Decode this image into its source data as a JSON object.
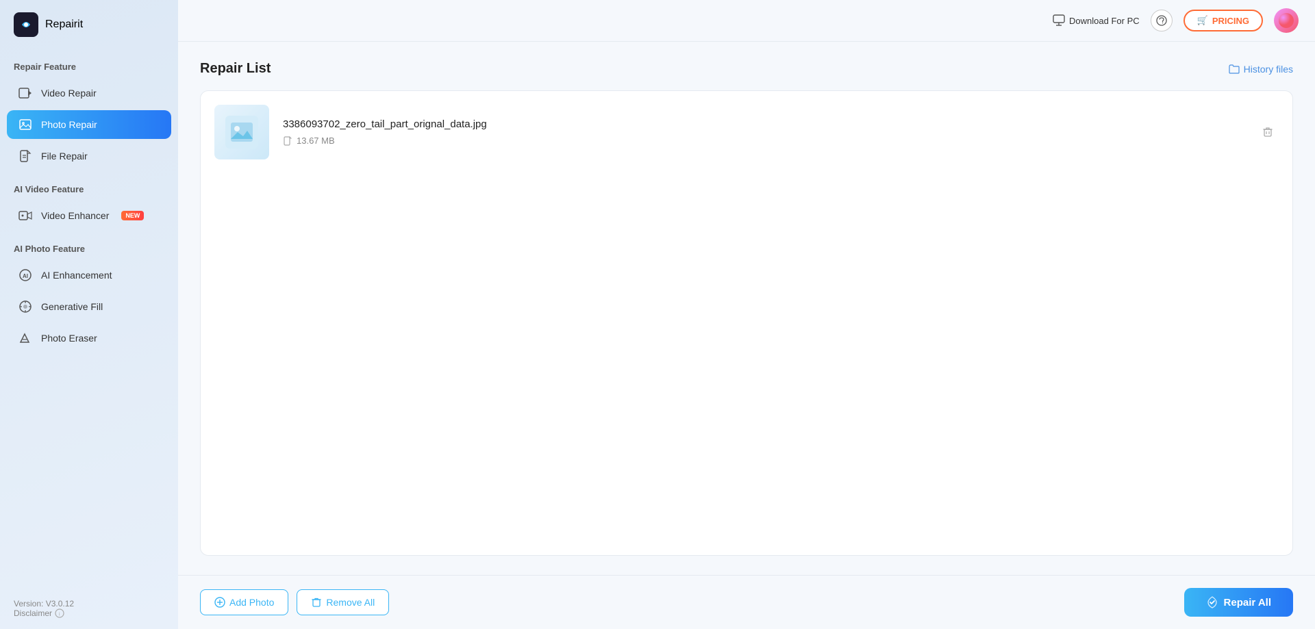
{
  "app": {
    "name": "Repairit"
  },
  "topbar": {
    "download_for_pc": "Download For PC",
    "pricing_label": "PRICING",
    "pricing_icon": "🛒"
  },
  "sidebar": {
    "repair_feature_label": "Repair Feature",
    "ai_video_feature_label": "AI Video Feature",
    "ai_photo_feature_label": "AI Photo Feature",
    "items": [
      {
        "id": "video-repair",
        "label": "Video Repair",
        "active": false,
        "badge": null
      },
      {
        "id": "photo-repair",
        "label": "Photo Repair",
        "active": true,
        "badge": null
      },
      {
        "id": "file-repair",
        "label": "File Repair",
        "active": false,
        "badge": null
      },
      {
        "id": "video-enhancer",
        "label": "Video Enhancer",
        "active": false,
        "badge": "NEW"
      },
      {
        "id": "ai-enhancement",
        "label": "AI Enhancement",
        "active": false,
        "badge": null
      },
      {
        "id": "generative-fill",
        "label": "Generative Fill",
        "active": false,
        "badge": null
      },
      {
        "id": "photo-eraser",
        "label": "Photo Eraser",
        "active": false,
        "badge": null
      }
    ],
    "version": "Version: V3.0.12",
    "disclaimer": "Disclaimer"
  },
  "content": {
    "title": "Repair List",
    "history_files_label": "History files",
    "files": [
      {
        "name": "3386093702_zero_tail_part_orignal_data.jpg",
        "size": "13.67 MB"
      }
    ]
  },
  "bottom": {
    "add_photo_label": "Add Photo",
    "remove_all_label": "Remove All",
    "repair_all_label": "Repair All"
  }
}
